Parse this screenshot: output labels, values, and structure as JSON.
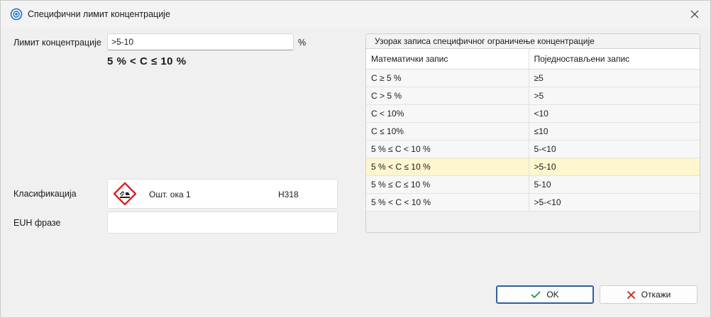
{
  "window": {
    "title": "Специфични лимит концентрације",
    "close_icon": "close-icon",
    "app_icon": "target-icon"
  },
  "form": {
    "limit_label": "Лимит концентрације",
    "limit_value": ">5-10",
    "unit": "%",
    "formula": "5 % < C ≤ 10 %",
    "classification_label": "Класификација",
    "classification": {
      "icon": "exclamation-hazard-icon",
      "name": "Ошт. ока 1",
      "code": "H318"
    },
    "euh_label": "EUH фразе",
    "euh_value": ""
  },
  "samples": {
    "title": "Узорак записа специфичног ограничење концентрације",
    "columns": [
      "Математички запис",
      "Поједностављени запис"
    ],
    "rows": [
      [
        "C ≥ 5 %",
        "≥5"
      ],
      [
        "C > 5 %",
        ">5"
      ],
      [
        "C < 10%",
        "<10"
      ],
      [
        "C ≤ 10%",
        "≤10"
      ],
      [
        "5 % ≤ C < 10 %",
        "5-<10"
      ],
      [
        "5 % < C ≤ 10 %",
        ">5-10"
      ],
      [
        "5 % ≤ C ≤ 10 %",
        "5-10"
      ],
      [
        "5 % < C < 10 %",
        ">5-<10"
      ]
    ],
    "highlighted_row": 5,
    "highlight_color": "#fdf6cf"
  },
  "buttons": {
    "ok_label": "OK",
    "cancel_label": "Откажи",
    "ok_icon": "check-icon",
    "cancel_icon": "x-icon",
    "ok_color": "#2e8b57",
    "cancel_color": "#c0392b"
  }
}
